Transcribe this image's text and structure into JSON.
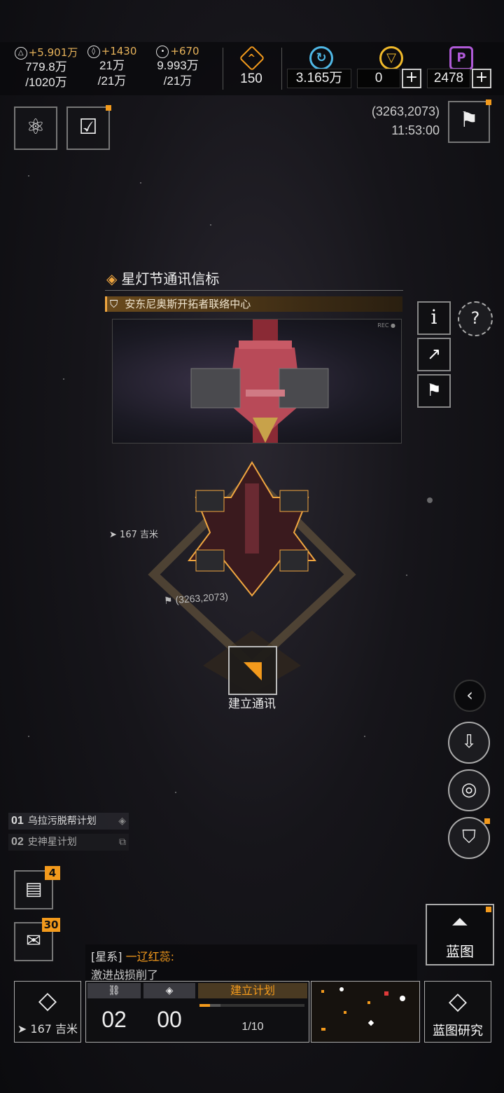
{
  "top_bar": {
    "resources": [
      {
        "icon": "crystal-icon",
        "gain": "+5.901万",
        "line1": "779.8万",
        "line2": "/1020万"
      },
      {
        "icon": "gem-icon",
        "gain": "+1430",
        "line1": "21万",
        "line2": "/21万"
      },
      {
        "icon": "orb-icon",
        "gain": "+670",
        "line1": "9.993万",
        "line2": "/21万"
      }
    ],
    "rank": {
      "icon": "rank-chevron-icon",
      "value": "150"
    },
    "currencies": [
      {
        "icon": "cycle-currency-icon",
        "value": "3.165万",
        "color": "#4fb8e6"
      },
      {
        "icon": "gold-currency-icon",
        "value": "0",
        "color": "#f0b92a"
      },
      {
        "icon": "purple-currency-icon",
        "value": "2478",
        "color": "#b05ad8"
      }
    ],
    "plus_label": "+"
  },
  "location": {
    "coords": "(3263,2073)",
    "time": "11:53:00"
  },
  "panel": {
    "title": "星灯节通讯信标",
    "owner": "安东尼奥斯开拓者联络中心",
    "rec": "REC ●"
  },
  "map": {
    "distance": "167 吉米",
    "coords": "(3263,2073)",
    "action_label": "建立通讯"
  },
  "tasks": [
    {
      "num": "01",
      "label": "乌拉污脱帮计划"
    },
    {
      "num": "02",
      "label": "史神星计划"
    }
  ],
  "badges": {
    "notes": "4",
    "mail": "30"
  },
  "chat": {
    "channel": "[星系]",
    "sender": "一辽红蕊:",
    "message": "激进战损削了"
  },
  "bottom": {
    "distance": "167 吉米",
    "counter1": "02",
    "counter2": "00",
    "plan_label": "建立计划",
    "plan_progress": "1/10",
    "blueprint_label": "蓝图",
    "blueprint_research_label": "蓝图研究"
  },
  "colors": {
    "accent": "#f39a1c",
    "gold": "#e6b25a"
  }
}
